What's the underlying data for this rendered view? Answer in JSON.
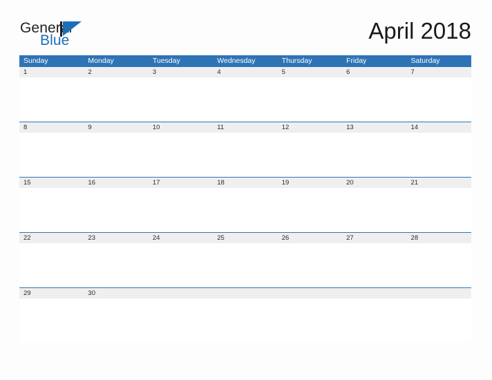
{
  "brand": {
    "name_part1": "General",
    "name_part2": "Blue",
    "logo_icon": "triangle-flag-icon",
    "color_primary": "#1a6fb5",
    "color_text": "#231f20"
  },
  "header": {
    "title": "April 2018"
  },
  "calendar": {
    "month": "April",
    "year": "2018",
    "header_bg": "#2e74b5",
    "header_text_color": "#ffffff",
    "date_strip_bg": "#efefef",
    "rule_color": "#2e74b5",
    "weekdays": [
      "Sunday",
      "Monday",
      "Tuesday",
      "Wednesday",
      "Thursday",
      "Friday",
      "Saturday"
    ],
    "weeks": [
      {
        "days": [
          {
            "date": "1",
            "events": ""
          },
          {
            "date": "2",
            "events": ""
          },
          {
            "date": "3",
            "events": ""
          },
          {
            "date": "4",
            "events": ""
          },
          {
            "date": "5",
            "events": ""
          },
          {
            "date": "6",
            "events": ""
          },
          {
            "date": "7",
            "events": ""
          }
        ]
      },
      {
        "days": [
          {
            "date": "8",
            "events": ""
          },
          {
            "date": "9",
            "events": ""
          },
          {
            "date": "10",
            "events": ""
          },
          {
            "date": "11",
            "events": ""
          },
          {
            "date": "12",
            "events": ""
          },
          {
            "date": "13",
            "events": ""
          },
          {
            "date": "14",
            "events": ""
          }
        ]
      },
      {
        "days": [
          {
            "date": "15",
            "events": ""
          },
          {
            "date": "16",
            "events": ""
          },
          {
            "date": "17",
            "events": ""
          },
          {
            "date": "18",
            "events": ""
          },
          {
            "date": "19",
            "events": ""
          },
          {
            "date": "20",
            "events": ""
          },
          {
            "date": "21",
            "events": ""
          }
        ]
      },
      {
        "days": [
          {
            "date": "22",
            "events": ""
          },
          {
            "date": "23",
            "events": ""
          },
          {
            "date": "24",
            "events": ""
          },
          {
            "date": "25",
            "events": ""
          },
          {
            "date": "26",
            "events": ""
          },
          {
            "date": "27",
            "events": ""
          },
          {
            "date": "28",
            "events": ""
          }
        ]
      },
      {
        "days": [
          {
            "date": "29",
            "events": ""
          },
          {
            "date": "30",
            "events": ""
          },
          {
            "date": "",
            "events": ""
          },
          {
            "date": "",
            "events": ""
          },
          {
            "date": "",
            "events": ""
          },
          {
            "date": "",
            "events": ""
          },
          {
            "date": "",
            "events": ""
          }
        ]
      }
    ]
  }
}
